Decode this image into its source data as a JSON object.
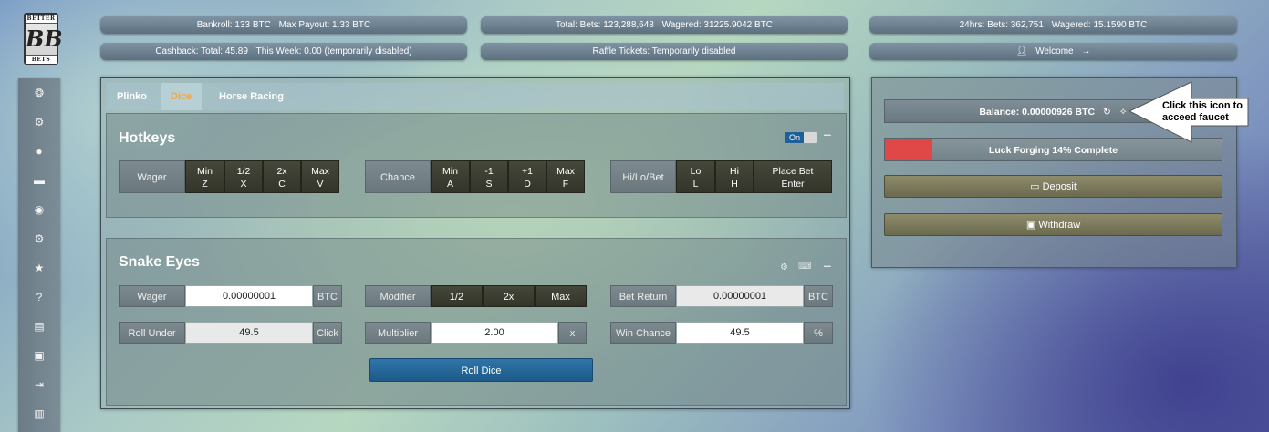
{
  "logo": {
    "top": "BETTER",
    "bottom": "BETS",
    "mark": "BB"
  },
  "stats": {
    "bankroll": "Bankroll: 133 BTC",
    "max_payout": "Max Payout: 1.33 BTC",
    "total_bets": "Total: Bets: 123,288,648",
    "total_wagered": "Wagered: 31225.9042 BTC",
    "day_bets": "24hrs: Bets: 362,751",
    "day_wagered": "Wagered: 15.1590 BTC",
    "cashback": "Cashback: Total: 45.89",
    "this_week": "This Week: 0.00 (temporarily disabled)",
    "raffle": "Raffle Tickets: Temporarily disabled",
    "welcome": "Welcome"
  },
  "nav_icons": [
    "games-icon",
    "settings-cogs-icon",
    "user-icon",
    "chat-icon",
    "hidden-eye-icon",
    "gear-icon",
    "trophy-icon",
    "help-icon",
    "news-icon",
    "ticket-icon",
    "logout-icon",
    "book-icon"
  ],
  "tabs": [
    "Plinko",
    "Dice",
    "Horse Racing"
  ],
  "active_tab": "Dice",
  "hotkeys": {
    "title": "Hotkeys",
    "toggle": "On",
    "wager_label": "Wager",
    "wager_keys": [
      {
        "action": "Min",
        "key": "Z"
      },
      {
        "action": "1/2",
        "key": "X"
      },
      {
        "action": "2x",
        "key": "C"
      },
      {
        "action": "Max",
        "key": "V"
      }
    ],
    "chance_label": "Chance",
    "chance_keys": [
      {
        "action": "Min",
        "key": "A"
      },
      {
        "action": "-1",
        "key": "S"
      },
      {
        "action": "+1",
        "key": "D"
      },
      {
        "action": "Max",
        "key": "F"
      }
    ],
    "hilo_label": "Hi/Lo/Bet",
    "hilo_keys": [
      {
        "action": "Lo",
        "key": "L"
      },
      {
        "action": "Hi",
        "key": "H"
      },
      {
        "action": "Place Bet",
        "key": "Enter"
      }
    ]
  },
  "game": {
    "title": "Snake Eyes",
    "wager_label": "Wager",
    "wager_value": "0.00000001",
    "wager_unit": "BTC",
    "roll_under_label": "Roll Under",
    "roll_under_value": "49.5",
    "roll_under_suffix": "Click",
    "modifier_label": "Modifier",
    "modifiers": [
      "1/2",
      "2x",
      "Max"
    ],
    "multiplier_label": "Multiplier",
    "multiplier_value": "2.00",
    "multiplier_suffix": "x",
    "bet_return_label": "Bet Return",
    "bet_return_value": "0.00000001",
    "bet_return_unit": "BTC",
    "win_chance_label": "Win Chance",
    "win_chance_value": "49.5",
    "win_chance_suffix": "%",
    "roll_button": "Roll Dice"
  },
  "account": {
    "balance": "Balance: 0.00000926 BTC",
    "luck_text": "Luck Forging 14% Complete",
    "luck_percent": 14,
    "deposit": "Deposit",
    "withdraw": "Withdraw"
  },
  "callout": {
    "text": "Click this icon to acceed faucet"
  }
}
